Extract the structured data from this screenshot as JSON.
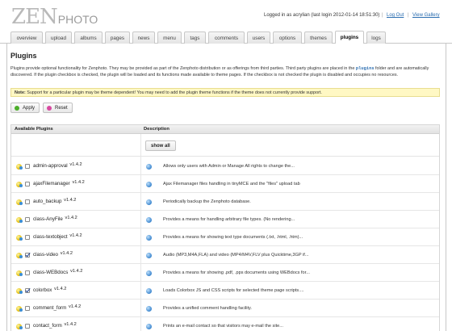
{
  "logo": {
    "zen": "ZEN",
    "photo": "PHOTO"
  },
  "header": {
    "user_info": "Logged in as acrylian (last login 2012-01-14 18:51:30)",
    "separator": "|",
    "logout": "Log Out",
    "view_gallery": "View Gallery"
  },
  "tabs": [
    {
      "label": "overview"
    },
    {
      "label": "upload"
    },
    {
      "label": "albums"
    },
    {
      "label": "pages"
    },
    {
      "label": "news"
    },
    {
      "label": "menu"
    },
    {
      "label": "tags"
    },
    {
      "label": "comments"
    },
    {
      "label": "users"
    },
    {
      "label": "options"
    },
    {
      "label": "themes"
    },
    {
      "label": "plugins"
    },
    {
      "label": "logs"
    }
  ],
  "active_tab": "plugins",
  "page": {
    "title": "Plugins",
    "intro_before": "Plugins provide optional functionality for Zenphoto. They may be provided as part of the Zenphoto distribution or as offerings from third parties. Third party plugins are placed in the ",
    "intro_code": "plugins",
    "intro_after": " folder and are automatically discovered. If the plugin checkbox is checked, the plugin will be loaded and its functions made available to theme pages. If the checkbox is not checked the plugin is disabled and occupies no resources.",
    "note_label": "Note:",
    "note_text": " Support for a particular plugin may be theme dependent! You may need to add the plugin theme functions if the theme does not currently provide support.",
    "apply_label": "Apply",
    "reset_label": "Reset"
  },
  "table": {
    "col_plugins": "Available Plugins",
    "col_description": "Description",
    "show_all": "show all",
    "rows": [
      {
        "name": "admin-approval",
        "version": "v1.4.2",
        "checked": false,
        "description": "Allows only users with Admin or Manage All rights to change the..."
      },
      {
        "name": "ajaxFilemanager",
        "version": "v1.4.2",
        "checked": false,
        "description": "Ajax Filemanager files handling in tinyMCE and the \"files\" upload tab"
      },
      {
        "name": "auto_backup",
        "version": "v1.4.2",
        "checked": false,
        "description": "Periodically backup the Zenphoto database."
      },
      {
        "name": "class-AnyFile",
        "version": "v1.4.2",
        "checked": false,
        "description": "Provides a means for handling arbitrary file types. (No rendering..."
      },
      {
        "name": "class-textobject",
        "version": "v1.4.2",
        "checked": false,
        "description": "Provides a means for showing text type documents (.txt, .html, .htm)..."
      },
      {
        "name": "class-video",
        "version": "v1.4.2",
        "checked": true,
        "description": "Audio (MP3,M4A,FLA) and video (MP4/M4V,FLV plus Quicktime,3GP if..."
      },
      {
        "name": "class-WEBdocs",
        "version": "v1.4.2",
        "checked": false,
        "description": "Provides a means for showing .pdf, .pps documents using WEBdocs for..."
      },
      {
        "name": "colorbox",
        "version": "v1.4.2",
        "checked": true,
        "description": "Loads Colorbox JS and CSS scripts for selected theme page scripts...."
      },
      {
        "name": "comment_form",
        "version": "v1.4.2",
        "checked": false,
        "description": "Provides a unified comment handling facility."
      },
      {
        "name": "contact_form",
        "version": "v1.4.2",
        "checked": false,
        "description": "Prints an e-mail contact so that visitors may e-mail the site..."
      }
    ]
  },
  "colors": {
    "link": "#2a6db0",
    "note_bg": "#fff8c4",
    "apply_icon": "#4caf2a",
    "reset_icon": "#d84aa0"
  },
  "icons": {
    "row_status": "plugin-status-icon",
    "row_info": "info-icon",
    "apply": "check-icon",
    "reset": "reset-icon"
  }
}
